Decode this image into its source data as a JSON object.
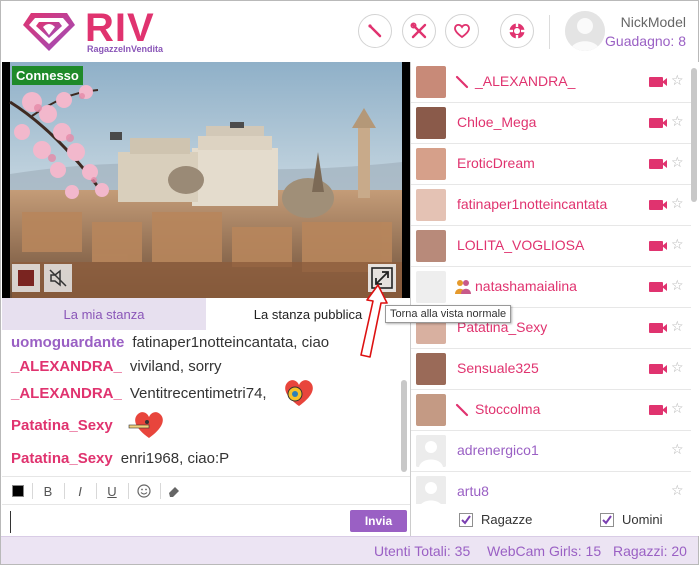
{
  "header": {
    "brand": "RIV",
    "tagline": "RagazzeInVendita",
    "username": "NickModel",
    "earnings": "Guadagno: 8",
    "icons": [
      "magic-wand-icon",
      "tools-icon",
      "heart-icon",
      "lifebuoy-icon"
    ]
  },
  "video": {
    "status": "Connesso"
  },
  "tabs": {
    "my_room": "La mia stanza",
    "public_room": "La stanza pubblica"
  },
  "tooltip": "Torna alla vista normale",
  "chat": [
    {
      "nick": "uomoguardante",
      "text": "fatinaper1notteincantata, ciao",
      "color": "#9a60c4"
    },
    {
      "nick": "_ALEXANDRA_",
      "text": "viviland, sorry",
      "color": "#e0336f"
    },
    {
      "nick": "_ALEXANDRA_",
      "text": "Ventitrecentimetri74,",
      "color": "#e0336f",
      "emoji": "kiss-heart-icon"
    },
    {
      "nick": "Patatina_Sexy",
      "text": "",
      "color": "#e0336f",
      "emoji": "smoking-heart-icon"
    },
    {
      "nick": "Patatina_Sexy",
      "text": "enri1968, ciao:P",
      "color": "#e0336f"
    }
  ],
  "toolbar": {
    "bold": "B",
    "italic": "I",
    "underline": "U"
  },
  "input": {
    "value": "",
    "send_label": "Invia"
  },
  "users": [
    {
      "name": "_ALEXANDRA_",
      "color": "#e0336f",
      "wand": true,
      "cam": true
    },
    {
      "name": "Chloe_Mega",
      "color": "#e0336f",
      "wand": false,
      "cam": true
    },
    {
      "name": "EroticDream",
      "color": "#e0336f",
      "wand": false,
      "cam": true
    },
    {
      "name": "fatinaper1notteincantata",
      "color": "#e0336f",
      "wand": false,
      "cam": true
    },
    {
      "name": "LOLITA_VOGLIOSA",
      "color": "#e0336f",
      "wand": false,
      "cam": true
    },
    {
      "name": "natashamaialina",
      "color": "#e0336f",
      "couple": true,
      "cam": true
    },
    {
      "name": "Patatina_Sexy",
      "color": "#e0336f",
      "wand": false,
      "cam": true
    },
    {
      "name": "Sensuale325",
      "color": "#e0336f",
      "wand": false,
      "cam": true
    },
    {
      "name": "Stoccolma",
      "color": "#e0336f",
      "wand": true,
      "cam": true
    },
    {
      "name": "adrenergico1",
      "color": "#9a60c4",
      "wand": false,
      "cam": false
    },
    {
      "name": "artu8",
      "color": "#9a60c4",
      "wand": false,
      "cam": false
    }
  ],
  "filters": {
    "girls": "Ragazze",
    "men": "Uomini"
  },
  "footer": {
    "total_users": "Utenti Totali: 35",
    "webcam_girls": "WebCam Girls: 15",
    "girls": "Ragazzi: 20"
  },
  "colors": {
    "pink": "#e0336f",
    "purple": "#9a60c4",
    "status_green": "#1f8a2a",
    "footer_bg": "#ece4f3"
  }
}
